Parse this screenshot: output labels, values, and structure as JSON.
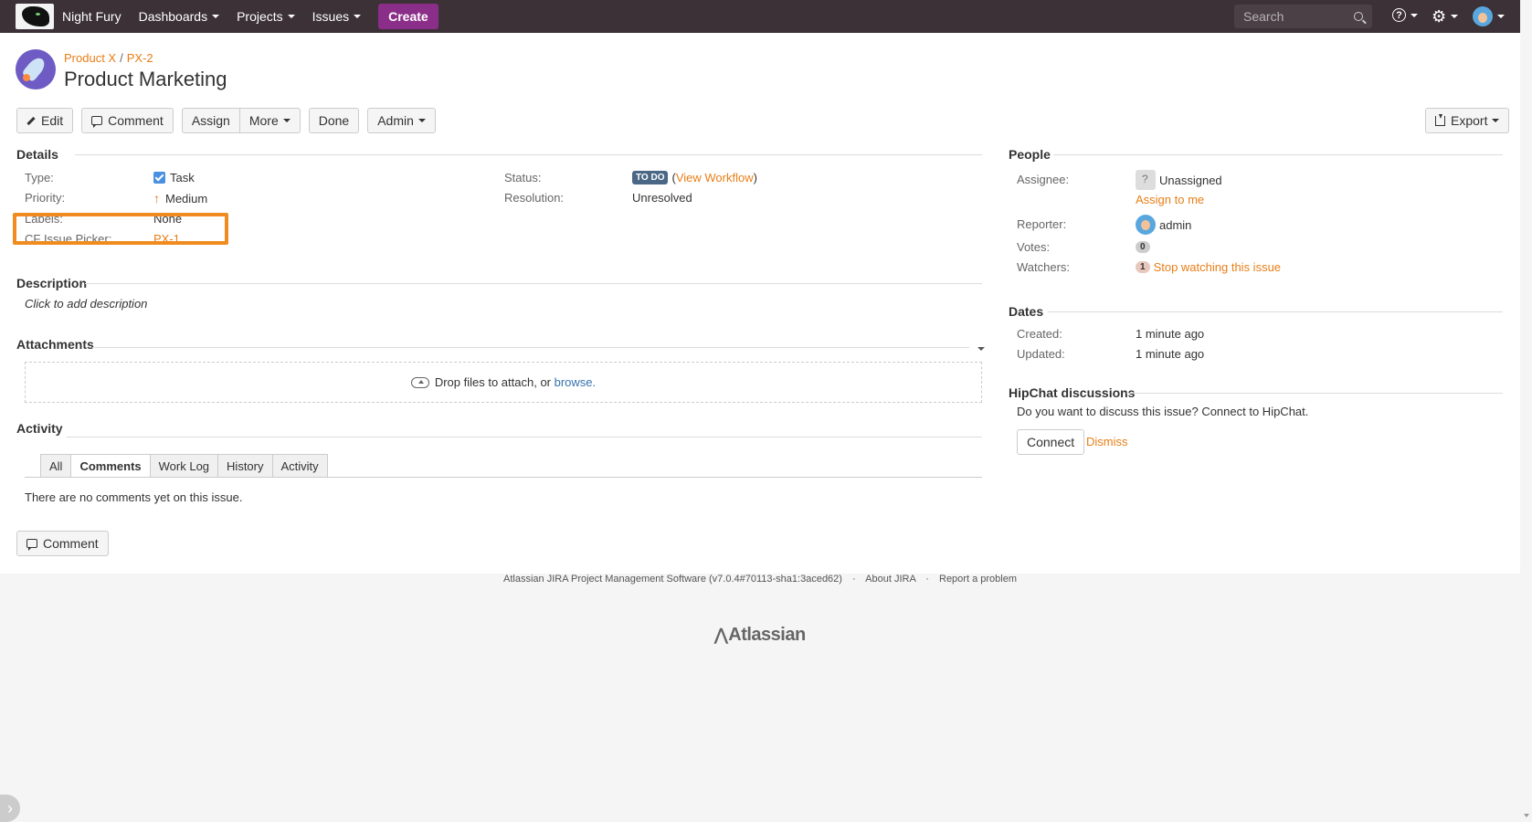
{
  "header": {
    "app_name": "Night Fury",
    "nav": [
      "Dashboards",
      "Projects",
      "Issues"
    ],
    "create_label": "Create",
    "search_placeholder": "Search"
  },
  "issue": {
    "breadcrumb_project": "Product X",
    "breadcrumb_sep": "/",
    "breadcrumb_key": "PX-2",
    "title": "Product Marketing"
  },
  "toolbar": {
    "edit": "Edit",
    "comment": "Comment",
    "assign": "Assign",
    "more": "More",
    "done": "Done",
    "admin": "Admin",
    "export": "Export"
  },
  "details": {
    "heading": "Details",
    "type_label": "Type:",
    "type_value": "Task",
    "priority_label": "Priority:",
    "priority_value": "Medium",
    "labels_label": "Labels:",
    "labels_value": "None",
    "cf_label": "CF Issue Picker:",
    "cf_value": "PX-1",
    "status_label": "Status:",
    "status_value": "TO DO",
    "status_link": "View Workflow",
    "resolution_label": "Resolution:",
    "resolution_value": "Unresolved"
  },
  "description": {
    "heading": "Description",
    "placeholder": "Click to add description"
  },
  "attachments": {
    "heading": "Attachments",
    "drop_text": "Drop files to attach, or",
    "browse": "browse."
  },
  "activity": {
    "heading": "Activity",
    "tabs": [
      "All",
      "Comments",
      "Work Log",
      "History",
      "Activity"
    ],
    "active_tab": "Comments",
    "empty": "There are no comments yet on this issue.",
    "comment_button": "Comment"
  },
  "people": {
    "heading": "People",
    "assignee_label": "Assignee:",
    "assignee_value": "Unassigned",
    "assign_to_me": "Assign to me",
    "reporter_label": "Reporter:",
    "reporter_value": "admin",
    "votes_label": "Votes:",
    "votes_count": "0",
    "watchers_label": "Watchers:",
    "watchers_count": "1",
    "stop_watching": "Stop watching this issue"
  },
  "dates": {
    "heading": "Dates",
    "created_label": "Created:",
    "created_value": "1 minute ago",
    "updated_label": "Updated:",
    "updated_value": "1 minute ago"
  },
  "hipchat": {
    "heading": "HipChat discussions",
    "text": "Do you want to discuss this issue? Connect to HipChat.",
    "connect": "Connect",
    "dismiss": "Dismiss"
  },
  "footer": {
    "software": "Atlassian JIRA Project Management Software (v7.0.4#70113-sha1:3aced62)",
    "about": "About JIRA",
    "report": "Report a problem",
    "logo": "Atlassian"
  },
  "colors": {
    "header_bg": "#3b3136",
    "create_btn": "#8b2e89",
    "link_orange": "#e87e17",
    "highlight_border": "#f08c1f",
    "status_lozenge": "#4a6785"
  }
}
